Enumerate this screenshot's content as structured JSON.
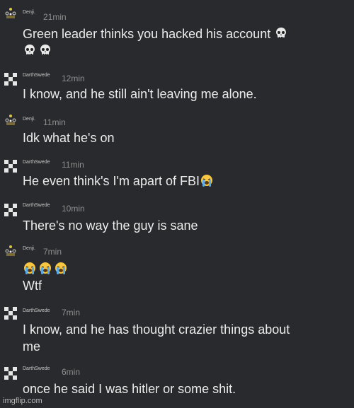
{
  "messages": [
    {
      "author": "Denji.",
      "time": "21min",
      "avatar": "cake-avatar-icon",
      "lines": [
        "Green leader thinks you hacked his account"
      ],
      "emoji": [
        "skull-emoji",
        "skull-emoji",
        "skull-emoji"
      ]
    },
    {
      "author": "DarthSwede",
      "time": "12min",
      "avatar": "checker-avatar-icon",
      "lines": [
        "I know, and he still ain't leaving me alone."
      ]
    },
    {
      "author": "Denji.",
      "time": "11min",
      "avatar": "cake-avatar-icon",
      "lines": [
        "Idk what he's on"
      ]
    },
    {
      "author": "DarthSwede",
      "time": "11min",
      "avatar": "checker-avatar-icon",
      "lines": [
        "He even think's I'm apart of FBI"
      ],
      "emoji": [
        "loudly-crying-emoji"
      ]
    },
    {
      "author": "DarthSwede",
      "time": "10min",
      "avatar": "checker-avatar-icon",
      "lines": [
        "There's no way the guy is sane"
      ]
    },
    {
      "author": "Denji.",
      "time": "7min",
      "avatar": "cake-avatar-icon",
      "lines": [
        "Wtf"
      ],
      "emoji": [
        "loudly-crying-emoji",
        "loudly-crying-emoji",
        "loudly-crying-emoji"
      ]
    },
    {
      "author": "DarthSwede",
      "time": "7min",
      "avatar": "checker-avatar-icon",
      "lines": [
        "I know, and he has thought crazier things about",
        "me"
      ]
    },
    {
      "author": "DarthSwede",
      "time": "6min",
      "avatar": "checker-avatar-icon",
      "lines": [
        "once he said I was hitler or some shit."
      ]
    }
  ],
  "watermark": "imgflip.com",
  "colors": {
    "background": "#292a2d",
    "text": "#ececec",
    "timestamp": "#8e8e8e",
    "emoji_face": "#f7c744",
    "emoji_tears": "#5aa9e6"
  }
}
